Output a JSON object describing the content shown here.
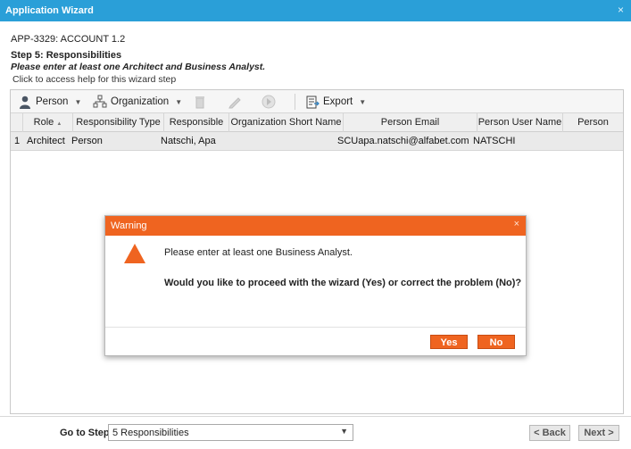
{
  "window": {
    "title": "Application Wizard",
    "close_glyph": "×"
  },
  "header": {
    "app_id": "APP-3329: ACCOUNT 1.2",
    "step_title": "Step 5: Responsibilities",
    "step_hint": "Please enter at least one Architect and Business Analyst.",
    "help_link": "Click to access help for this wizard step"
  },
  "toolbar": {
    "person_label": "Person",
    "organization_label": "Organization",
    "export_label": "Export",
    "caret": "▼",
    "icons": [
      "person-icon",
      "organization-icon",
      "delete-icon",
      "edit-icon",
      "go-icon",
      "export-icon"
    ]
  },
  "grid": {
    "columns": [
      "Role",
      "Responsibility Type",
      "Responsible",
      "Organization Short Name",
      "Person Email",
      "Person User Name",
      "Person Phone"
    ],
    "sort_indicator": "▲",
    "rows": [
      {
        "index": "1",
        "role": "Architect",
        "type": "Person",
        "responsible": "Natschi, Apa",
        "org_short": "",
        "email": "SCUapa.natschi@alfabet.com",
        "user": "NATSCHI",
        "phone": ""
      }
    ]
  },
  "dialog": {
    "title": "Warning",
    "close_glyph": "×",
    "message": "Please enter at least one Business Analyst.",
    "question": "Would you like to proceed with the wizard (Yes) or correct the problem (No)?",
    "yes_label": "Yes",
    "no_label": "No",
    "accent_color": "#ef6420"
  },
  "footer": {
    "goto_label": "Go to Step:",
    "selected_step": "5 Responsibilities",
    "select_arrow": "▼",
    "back_label": "< Back",
    "next_label": "Next >"
  }
}
